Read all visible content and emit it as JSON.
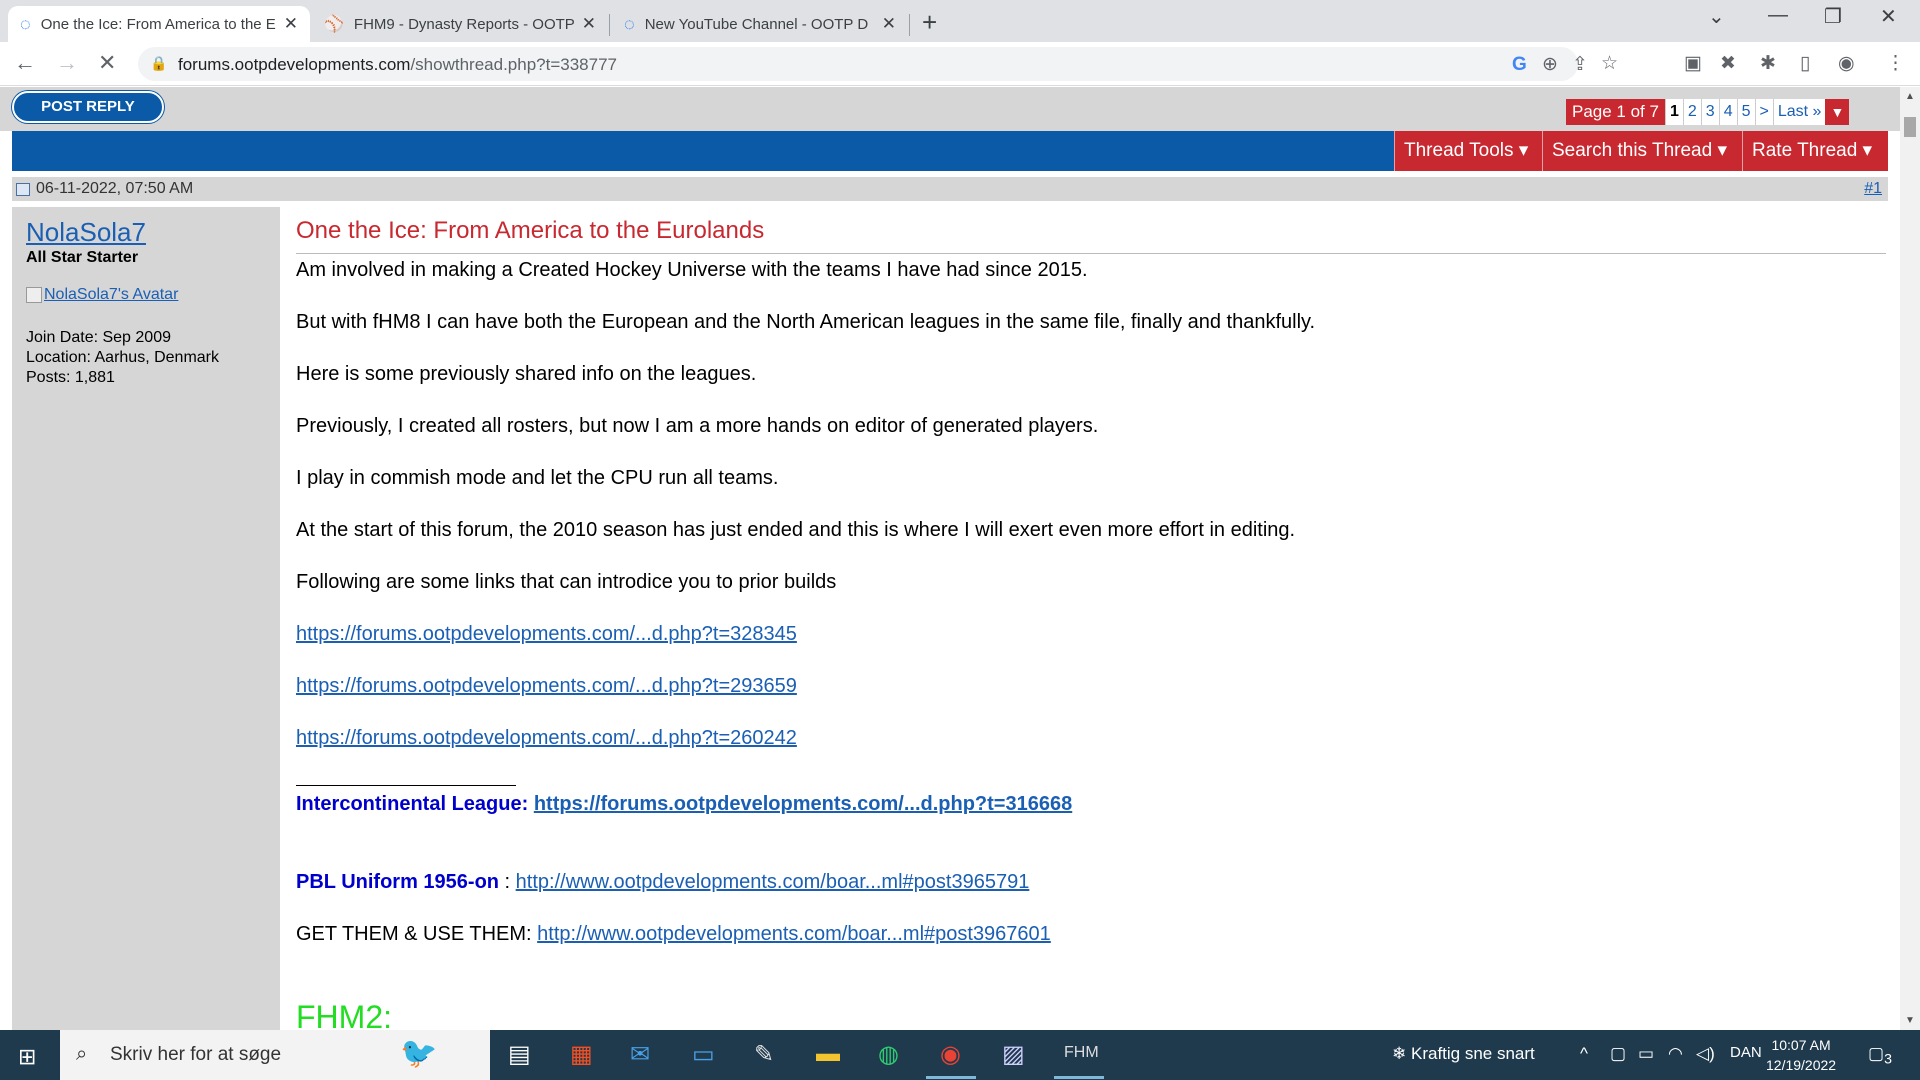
{
  "browser": {
    "tabs": [
      {
        "title": "One the Ice: From America to the Eurolands",
        "icon": "loading-spinner"
      },
      {
        "title": "FHM9 - Dynasty Reports - OOTP",
        "icon": "ootp-favicon"
      },
      {
        "title": "New YouTube Channel - OOTP D",
        "icon": "loading-spinner"
      }
    ],
    "new_tab": "+",
    "url_domain": "forums.ootpdevelopments.com",
    "url_path": "/showthread.php?t=338777"
  },
  "forum": {
    "post_reply": "POST REPLY",
    "pager": {
      "label": "Page 1 of 7",
      "pages": [
        "1",
        "2",
        "3",
        "4",
        "5"
      ],
      "next": ">",
      "last": "Last »"
    },
    "tools": {
      "thread_tools": "Thread Tools",
      "search_thread": "Search this Thread",
      "rate_thread": "Rate Thread"
    }
  },
  "post": {
    "date": "06-11-2022, 07:50 AM",
    "number": "#1",
    "author": {
      "name": "NolaSola7",
      "title": "All Star Starter",
      "avatar_alt": "NolaSola7's Avatar",
      "join_date": "Join Date: Sep 2009",
      "location": "Location: Aarhus, Denmark",
      "posts": "Posts: 1,881"
    },
    "title": "One the Ice: From America to the Eurolands",
    "paragraphs": [
      "Am involved in making a Created Hockey Universe with the teams I have had since 2015.",
      "But with fHM8 I can have both the European and the North American leagues in the same file, finally and thankfully.",
      "Here is some previously shared info on the leagues.",
      "Previously, I created all rosters, but now I am a more hands on editor of generated players.",
      "I play in commish mode and let the CPU run all teams.",
      "At the start of this forum, the 2010 season has just ended and this is where I will exert even more effort in editing.",
      "Following are some links that can introdice you to prior builds"
    ],
    "links": [
      "https://forums.ootpdevelopments.com/...d.php?t=328345",
      "https://forums.ootpdevelopments.com/...d.php?t=293659",
      "https://forums.ootpdevelopments.com/...d.php?t=260242"
    ],
    "signature": {
      "intercontinental_label": "Intercontinental League:",
      "intercontinental_link": "https://forums.ootpdevelopments.com/...d.php?t=316668",
      "pbl_label": "PBL Uniform 1956-on",
      "pbl_sep": " : ",
      "pbl_link": "http://www.ootpdevelopments.com/boar...ml#post3965791",
      "get_label": "GET THEM & USE THEM: ",
      "get_link": "http://www.ootpdevelopments.com/boar...ml#post3967601",
      "fhm2": "FHM2:"
    }
  },
  "taskbar": {
    "search_placeholder": "Skriv her for at søge",
    "weather": "Kraftig sne snart",
    "language": "DAN",
    "time": "10:07 AM",
    "date": "12/19/2022",
    "notifications": "3"
  }
}
